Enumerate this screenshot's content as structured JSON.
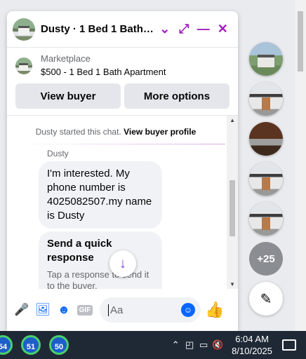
{
  "chat": {
    "title": "Dusty · 1 Bed 1 Bath A...",
    "listing_category": "Marketplace",
    "listing_title": "$500 - 1 Bed 1 Bath Apartment",
    "view_buyer": "View buyer",
    "more_options": "More options",
    "system_message": "Dusty started this chat.",
    "view_profile": "View buyer profile",
    "sender": "Dusty",
    "message": "I'm interested. My phone number is 4025082507.my name is Dusty",
    "quick_title": "Send a quick response",
    "quick_sub": "Tap a response to send it to the buyer.",
    "input_placeholder": "Aa"
  },
  "right_column": {
    "more_count": "+25"
  },
  "taskbar": {
    "apps": [
      "54",
      "51",
      "50"
    ],
    "time": "6:04 AM",
    "date": "8/10/2025"
  }
}
